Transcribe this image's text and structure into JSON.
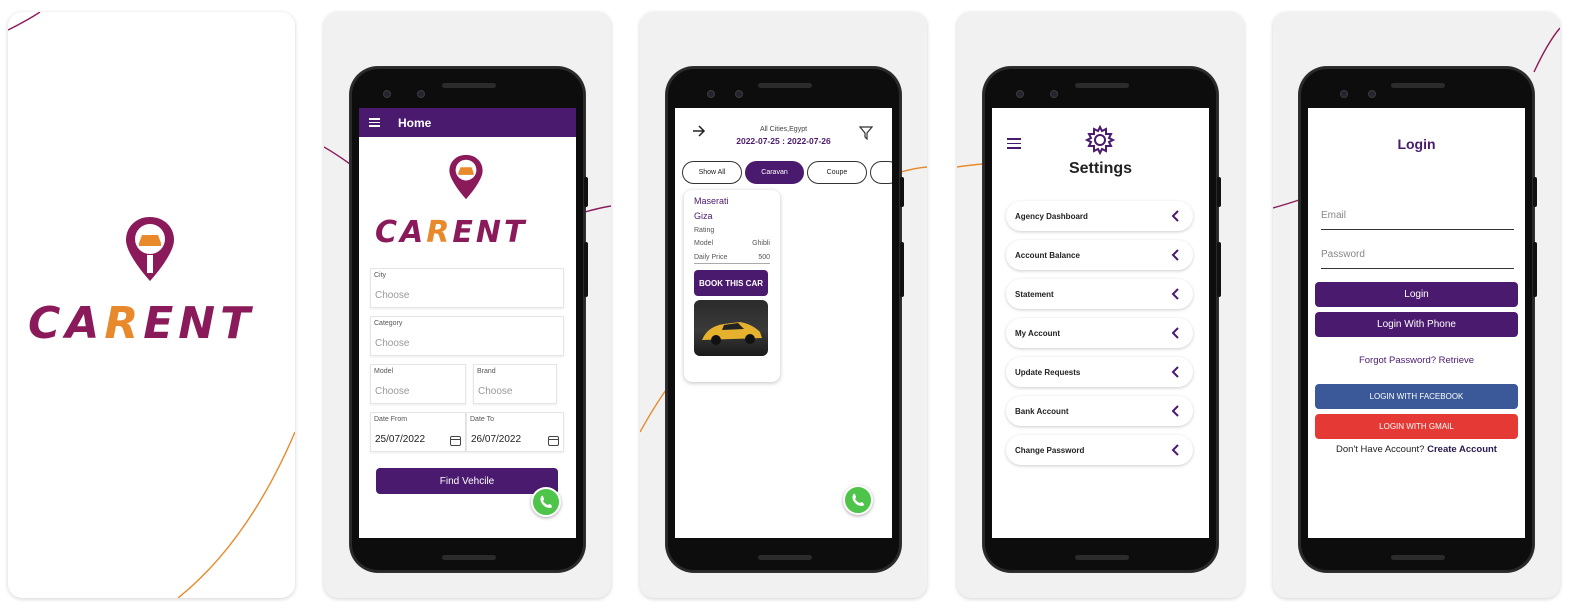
{
  "colors": {
    "purple": "#4a1a6e",
    "magenta": "#8a1a5a",
    "orange": "#e8892c",
    "facebook": "#3b5998",
    "gmail": "#e53935",
    "whatsapp": "#4ec44a"
  },
  "logo": {
    "brand_prefix": "CA",
    "brand_r": "R",
    "brand_suffix": "ENT"
  },
  "home": {
    "title": "Home",
    "city_label": "City",
    "city_value": "Choose",
    "category_label": "Category",
    "category_value": "Choose",
    "model_label": "Model",
    "model_value": "Choose",
    "brand_label": "Brand",
    "brand_value": "Choose",
    "date_from_label": "Date From",
    "date_from_value": "25/07/2022",
    "date_to_label": "Date To",
    "date_to_value": "26/07/2022",
    "find_button": "Find Vehcile"
  },
  "results": {
    "location": "All Cities,Egypt",
    "dates": "2022-07-25 : 2022-07-26",
    "chips": [
      "Show All",
      "Caravan",
      "Coupe"
    ],
    "active_chip": "Caravan",
    "car": {
      "name": "Maserati",
      "city": "Giza",
      "rating_label": "Rating",
      "model_label": "Model",
      "model_value": "Ghibli",
      "price_label": "Daily Price",
      "price_value": "500",
      "book_button": "BOOK THIS CAR"
    }
  },
  "settings": {
    "title": "Settings",
    "items": [
      "Agency Dashboard",
      "Account Balance",
      "Statement",
      "My Account",
      "Update Requests",
      "Bank Account",
      "Change Password"
    ]
  },
  "login": {
    "title": "Login",
    "email_placeholder": "Email",
    "password_placeholder": "Password",
    "login_button": "Login",
    "phone_button": "Login With Phone",
    "forgot_text": "Forgot Password? Retrieve",
    "facebook_button": "LOGIN WITH FACEBOOK",
    "gmail_button": "LOGIN WITH GMAIL",
    "no_account_text": "Don't Have Account?",
    "create_account_link": "Create Account"
  }
}
